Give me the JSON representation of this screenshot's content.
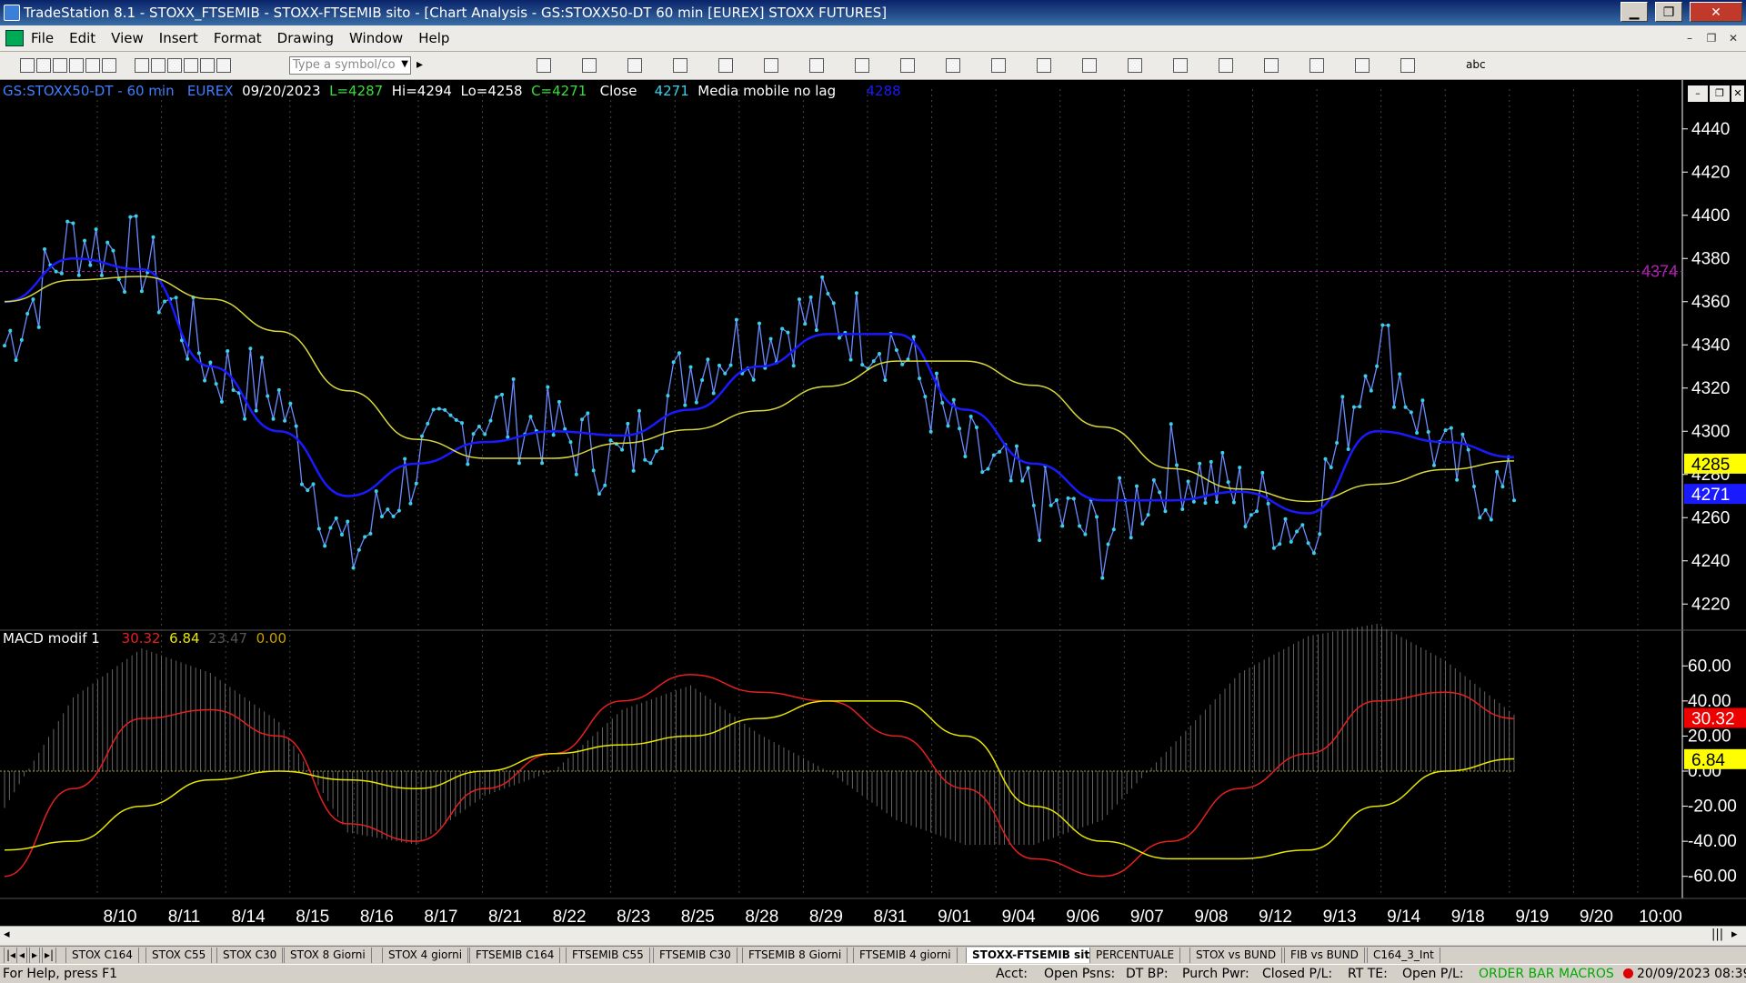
{
  "window": {
    "title": "TradeStation 8.1 - STOXX_FTSEMIB - STOXX-FTSEMIB sito - [Chart Analysis - GS:STOXX50-DT  60 min  [EUREX] STOXX FUTURES]",
    "minimize_label": "▁",
    "maximize_label": "❐",
    "close_label": "✕"
  },
  "menu": {
    "items": [
      "File",
      "Edit",
      "View",
      "Insert",
      "Format",
      "Drawing",
      "Window",
      "Help"
    ],
    "mdi_min": "–",
    "mdi_restore": "❐",
    "mdi_close": "✕"
  },
  "toolbar": {
    "symbol_placeholder": "Type a symbol/co",
    "dropdown_glyph": "▼",
    "play_glyph": "▸",
    "text_tool": "abc"
  },
  "chart": {
    "header": {
      "symbol": "GS:STOXX50-DT - 60 min",
      "exchange": "EUREX",
      "date": "09/20/2023",
      "last": "L=4287",
      "high": "Hi=4294",
      "low": "Lo=4258",
      "close": "C=4271",
      "close_label": "Close",
      "close_value": "4271",
      "ma_label": "Media mobile no lag",
      "ma_value": "4288"
    },
    "macd_header": {
      "name": "MACD modif 1",
      "v1": "30.32",
      "v2": "6.84",
      "v3": "23.47",
      "v4": "0.00"
    },
    "price_labels": {
      "hline": "4374",
      "yellow": "4285",
      "blue": "4271"
    },
    "macd_labels": {
      "red": "30.32",
      "yellow": "6.84"
    },
    "colors": {
      "price": "#3ad0e8",
      "ma_blue": "#1a1aff",
      "ma_yellow": "#d8d83a",
      "macd_red": "#e62020",
      "macd_yellow": "#e6e600",
      "hline": "#b020b0"
    },
    "price_ticks": [
      "4440",
      "4420",
      "4400",
      "4380",
      "4360",
      "4340",
      "4320",
      "4300",
      "4280",
      "4260",
      "4240",
      "4220"
    ],
    "macd_ticks": [
      "60.00",
      "40.00",
      "20.00",
      "0.00",
      "-20.00",
      "-40.00",
      "-60.00"
    ],
    "date_labels": [
      "8/10",
      "8/11",
      "8/14",
      "8/15",
      "8/16",
      "8/17",
      "8/21",
      "8/22",
      "8/23",
      "8/25",
      "8/28",
      "8/29",
      "8/31",
      "9/01",
      "9/04",
      "9/06",
      "9/07",
      "9/08",
      "9/12",
      "9/13",
      "9/14",
      "9/18",
      "9/19",
      "9/20",
      "10:00"
    ]
  },
  "chart_data": {
    "type": "line",
    "x": [
      "8/10",
      "8/11",
      "8/14",
      "8/15",
      "8/16",
      "8/17",
      "8/21",
      "8/22",
      "8/23",
      "8/25",
      "8/28",
      "8/29",
      "8/31",
      "9/01",
      "9/04",
      "9/06",
      "9/07",
      "9/08",
      "9/12",
      "9/13",
      "9/14",
      "9/18",
      "9/19"
    ],
    "series": [
      {
        "name": "Close",
        "values": [
          4340,
          4390,
          4380,
          4330,
          4315,
          4240,
          4285,
          4310,
          4300,
          4285,
          4330,
          4345,
          4355,
          4340,
          4290,
          4268,
          4250,
          4285,
          4270,
          4255,
          4345,
          4285,
          4268
        ]
      },
      {
        "name": "Media mobile no lag",
        "values": [
          4360,
          4380,
          4375,
          4330,
          4300,
          4270,
          4285,
          4295,
          4300,
          4298,
          4310,
          4330,
          4345,
          4345,
          4310,
          4285,
          4268,
          4268,
          4272,
          4262,
          4300,
          4295,
          4288
        ]
      }
    ],
    "ylim": [
      4210,
      4450
    ],
    "hline": 4374,
    "macd": {
      "red": [
        -60,
        -10,
        30,
        35,
        20,
        -30,
        -40,
        -10,
        10,
        40,
        55,
        45,
        40,
        20,
        -10,
        -50,
        -60,
        -40,
        -10,
        10,
        40,
        45,
        30
      ],
      "yellow": [
        -45,
        -40,
        -20,
        -5,
        0,
        -5,
        -10,
        0,
        10,
        15,
        20,
        30,
        40,
        40,
        20,
        -20,
        -40,
        -50,
        -50,
        -45,
        -20,
        0,
        7
      ],
      "ylim": [
        -70,
        70
      ]
    }
  },
  "tabs": {
    "items": [
      "STOX C164",
      "STOX C55",
      "STOX C30",
      "STOX 8 Giorni",
      "STOX 4 giorni",
      "FTSEMIB C164",
      "FTSEMIB C55",
      "FTSEMIB C30",
      "FTSEMIB 8 Giorni",
      "FTSEMIB 4 giorni",
      "STOXX-FTSEMIB sito",
      "PERCENTUALE",
      "STOX vs BUND",
      "FIB vs BUND",
      "C164_3_Int"
    ],
    "active_index": 10,
    "nav": [
      "|◂",
      "◂",
      "▸",
      "▸|"
    ]
  },
  "status": {
    "help": "For Help, press F1",
    "acct": "Acct:",
    "open_psns": "Open Psns:",
    "dt_bp": "DT BP:",
    "purch_pwr": "Purch Pwr:",
    "closed_pl": "Closed P/L:",
    "rt_te": "RT TE:",
    "open_pl": "Open P/L:",
    "order_bar": "ORDER BAR",
    "macros": "MACROS",
    "datetime": "20/09/2023 08:39"
  }
}
